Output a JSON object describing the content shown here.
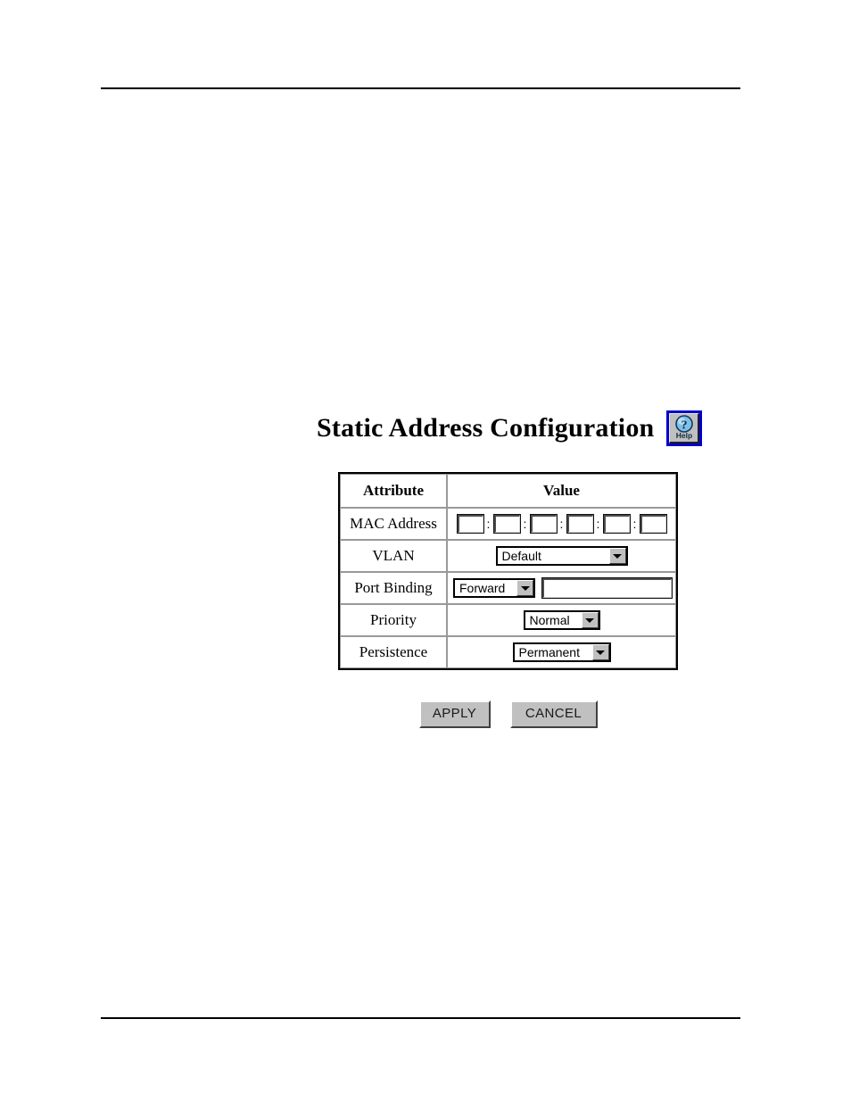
{
  "page": {
    "title": "Static Address Configuration",
    "rules": {
      "top": true,
      "bottom": true
    }
  },
  "help": {
    "name": "help-button",
    "label": "Help",
    "glyph": "?",
    "border_color": "#0000cc",
    "face_color": "#c0c0c0",
    "circle_color": "#5a9fd4"
  },
  "table": {
    "headers": [
      "Attribute",
      "Value"
    ],
    "rows": [
      {
        "attribute": "MAC Address",
        "control": "mac-octets",
        "octets": [
          "",
          "",
          "",
          "",
          "",
          ""
        ],
        "separator": ":"
      },
      {
        "attribute": "VLAN",
        "control": "select",
        "value": "Default"
      },
      {
        "attribute": "Port Binding",
        "control": "select-plus-text",
        "value": "Forward",
        "text_value": ""
      },
      {
        "attribute": "Priority",
        "control": "select",
        "value": "Normal"
      },
      {
        "attribute": "Persistence",
        "control": "select",
        "value": "Permanent"
      }
    ]
  },
  "buttons": {
    "apply": "APPLY",
    "cancel": "CANCEL"
  }
}
